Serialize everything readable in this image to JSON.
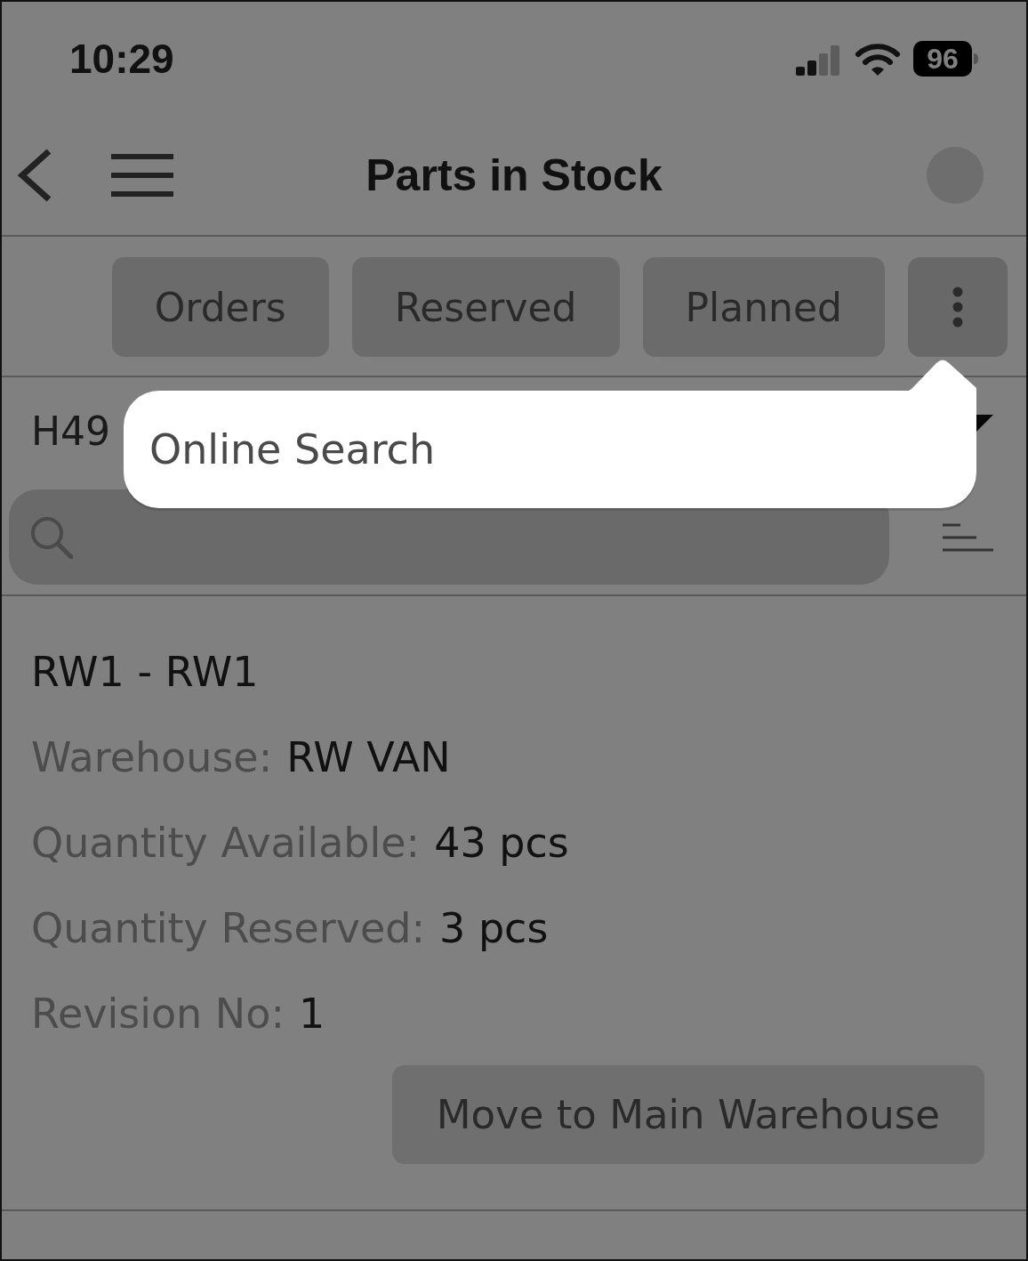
{
  "status_bar": {
    "time": "10:29",
    "battery": "96"
  },
  "nav_bar": {
    "title": "Parts in Stock"
  },
  "toolbar": {
    "buttons": [
      {
        "label": "Orders"
      },
      {
        "label": "Reserved"
      },
      {
        "label": "Planned"
      }
    ],
    "more_menu": {
      "expanded": true,
      "items": [
        {
          "label": "Online Search"
        }
      ]
    }
  },
  "selector": {
    "value": "H49"
  },
  "stock_items": [
    {
      "title": "RW1 - RW1",
      "fields": [
        {
          "label": "Warehouse:",
          "value": "RW VAN"
        },
        {
          "label": "Quantity Available:",
          "value": "43 pcs"
        },
        {
          "label": "Quantity Reserved:",
          "value": "3 pcs"
        },
        {
          "label": "Revision No:",
          "value": "1"
        }
      ],
      "action": "Move to Main Warehouse"
    }
  ]
}
